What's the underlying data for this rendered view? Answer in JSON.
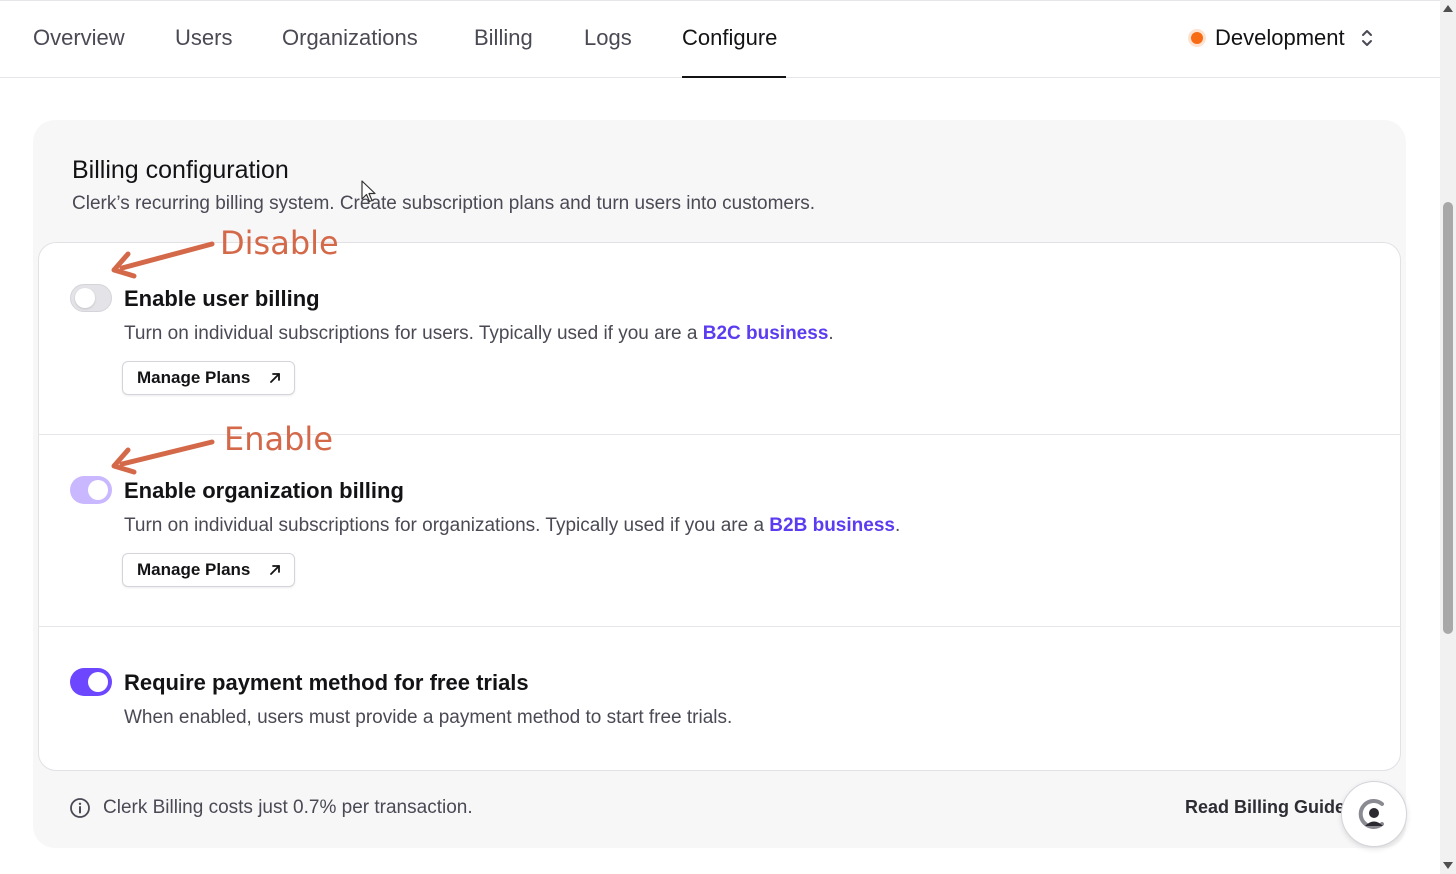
{
  "nav": {
    "tabs": [
      {
        "label": "Overview"
      },
      {
        "label": "Users"
      },
      {
        "label": "Organizations"
      },
      {
        "label": "Billing"
      },
      {
        "label": "Logs"
      },
      {
        "label": "Configure",
        "active": true
      }
    ],
    "environment": {
      "label": "Development",
      "dot_color": "#f76b15"
    }
  },
  "billing": {
    "title": "Billing configuration",
    "subtitle": "Clerk’s recurring billing system. Create subscription plans and turn users into customers.",
    "rows": [
      {
        "title": "Enable user billing",
        "desc_prefix": "Turn on individual subscriptions for users. Typically used if you are a ",
        "desc_link": "B2C business",
        "desc_suffix": ".",
        "button": "Manage Plans",
        "toggle": "off",
        "annotation": "Disable"
      },
      {
        "title": "Enable organization billing",
        "desc_prefix": "Turn on individual subscriptions for organizations. Typically used if you are a ",
        "desc_link": "B2B business",
        "desc_suffix": ".",
        "button": "Manage Plans",
        "toggle": "on-disabled",
        "annotation": "Enable"
      },
      {
        "title": "Require payment method for free trials",
        "desc": "When enabled, users must provide a payment method to start free trials.",
        "toggle": "on"
      }
    ],
    "footer": {
      "info": "Clerk Billing costs just 0.7% per transaction.",
      "guide_link": "Read Billing Guide"
    }
  },
  "colors": {
    "accent": "#6c47ff",
    "link": "#5b3cf0",
    "annotation": "#d4694a"
  }
}
